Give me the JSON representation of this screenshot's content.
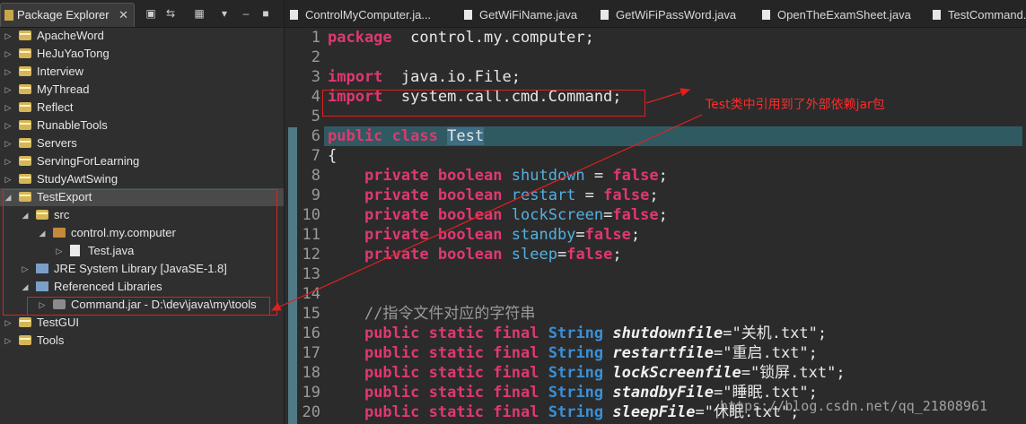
{
  "explorer": {
    "tab_label": "Package Explorer",
    "close_glyph": "✕",
    "items": [
      {
        "label": "ApacheWord",
        "depth": 0,
        "arrow": "right",
        "icon": "project-icon"
      },
      {
        "label": "HeJuYaoTong",
        "depth": 0,
        "arrow": "right",
        "icon": "project-icon"
      },
      {
        "label": "Interview",
        "depth": 0,
        "arrow": "right",
        "icon": "project-icon"
      },
      {
        "label": "MyThread",
        "depth": 0,
        "arrow": "right",
        "icon": "project-icon"
      },
      {
        "label": "Reflect",
        "depth": 0,
        "arrow": "right",
        "icon": "project-icon"
      },
      {
        "label": "RunableTools",
        "depth": 0,
        "arrow": "right",
        "icon": "project-icon"
      },
      {
        "label": "Servers",
        "depth": 0,
        "arrow": "right",
        "icon": "project-icon"
      },
      {
        "label": "ServingForLearning",
        "depth": 0,
        "arrow": "right",
        "icon": "project-icon"
      },
      {
        "label": "StudyAwtSwing",
        "depth": 0,
        "arrow": "right",
        "icon": "project-icon"
      },
      {
        "label": "TestExport",
        "depth": 0,
        "arrow": "down",
        "icon": "project-icon",
        "selected": true
      },
      {
        "label": "src",
        "depth": 1,
        "arrow": "down",
        "icon": "source-folder-icon"
      },
      {
        "label": "control.my.computer",
        "depth": 2,
        "arrow": "down",
        "icon": "package-icon"
      },
      {
        "label": "Test.java",
        "depth": 3,
        "arrow": "right",
        "icon": "java-file-icon"
      },
      {
        "label": "JRE System Library [JavaSE-1.8]",
        "depth": 1,
        "arrow": "right",
        "icon": "library-icon"
      },
      {
        "label": "Referenced Libraries",
        "depth": 1,
        "arrow": "down",
        "icon": "library-icon"
      },
      {
        "label": "Command.jar - D:\\dev\\java\\my\\tools",
        "depth": 2,
        "arrow": "right",
        "icon": "jar-icon"
      },
      {
        "label": "TestGUI",
        "depth": 0,
        "arrow": "right",
        "icon": "project-icon"
      },
      {
        "label": "Tools",
        "depth": 0,
        "arrow": "right",
        "icon": "project-icon"
      }
    ]
  },
  "editor": {
    "tabs": [
      {
        "label": "ControlMyComputer.ja..."
      },
      {
        "label": "GetWiFiName.java"
      },
      {
        "label": "GetWiFiPassWord.java"
      },
      {
        "label": "OpenTheExamSheet.java"
      },
      {
        "label": "TestCommand."
      }
    ],
    "lines": [
      {
        "n": "1",
        "tokens": [
          [
            "kw",
            "package"
          ],
          [
            "",
            "  control.my.computer;"
          ]
        ]
      },
      {
        "n": "2",
        "tokens": []
      },
      {
        "n": "3",
        "tokens": [
          [
            "kw",
            "import"
          ],
          [
            "",
            "  java.io.File;"
          ]
        ]
      },
      {
        "n": "4",
        "tokens": [
          [
            "kw",
            "import"
          ],
          [
            "",
            "  system.call.cmd.Command;"
          ]
        ]
      },
      {
        "n": "5",
        "tokens": []
      },
      {
        "n": "6",
        "tokens": [
          [
            "kw",
            "public"
          ],
          [
            "",
            " "
          ],
          [
            "kw",
            "class"
          ],
          [
            "",
            " "
          ],
          [
            "cls",
            "Test"
          ]
        ]
      },
      {
        "n": "7",
        "tokens": [
          [
            "",
            "{"
          ]
        ]
      },
      {
        "n": "8",
        "tokens": [
          [
            "",
            "    "
          ],
          [
            "kw",
            "private"
          ],
          [
            "",
            " "
          ],
          [
            "kw",
            "boolean"
          ],
          [
            "",
            " "
          ],
          [
            "fld",
            "shutdown"
          ],
          [
            "",
            " = "
          ],
          [
            "kw",
            "false"
          ],
          [
            "",
            ";"
          ]
        ]
      },
      {
        "n": "9",
        "tokens": [
          [
            "",
            "    "
          ],
          [
            "kw",
            "private"
          ],
          [
            "",
            " "
          ],
          [
            "kw",
            "boolean"
          ],
          [
            "",
            " "
          ],
          [
            "fld",
            "restart"
          ],
          [
            "",
            " = "
          ],
          [
            "kw",
            "false"
          ],
          [
            "",
            ";"
          ]
        ]
      },
      {
        "n": "10",
        "tokens": [
          [
            "",
            "    "
          ],
          [
            "kw",
            "private"
          ],
          [
            "",
            " "
          ],
          [
            "kw",
            "boolean"
          ],
          [
            "",
            " "
          ],
          [
            "fld",
            "lockScreen"
          ],
          [
            "",
            "="
          ],
          [
            "kw",
            "false"
          ],
          [
            "",
            ";"
          ]
        ]
      },
      {
        "n": "11",
        "tokens": [
          [
            "",
            "    "
          ],
          [
            "kw",
            "private"
          ],
          [
            "",
            " "
          ],
          [
            "kw",
            "boolean"
          ],
          [
            "",
            " "
          ],
          [
            "fld",
            "standby"
          ],
          [
            "",
            "="
          ],
          [
            "kw",
            "false"
          ],
          [
            "",
            ";"
          ]
        ]
      },
      {
        "n": "12",
        "tokens": [
          [
            "",
            "    "
          ],
          [
            "kw",
            "private"
          ],
          [
            "",
            " "
          ],
          [
            "kw",
            "boolean"
          ],
          [
            "",
            " "
          ],
          [
            "fld",
            "sleep"
          ],
          [
            "",
            "="
          ],
          [
            "kw",
            "false"
          ],
          [
            "",
            ";"
          ]
        ]
      },
      {
        "n": "13",
        "tokens": []
      },
      {
        "n": "14",
        "tokens": []
      },
      {
        "n": "15",
        "tokens": [
          [
            "",
            "    "
          ],
          [
            "cmt",
            "//指令文件对应的字符串"
          ]
        ]
      },
      {
        "n": "16",
        "tokens": [
          [
            "",
            "    "
          ],
          [
            "kw",
            "public"
          ],
          [
            "",
            " "
          ],
          [
            "kw",
            "static"
          ],
          [
            "",
            " "
          ],
          [
            "kw",
            "final"
          ],
          [
            "",
            " "
          ],
          [
            "ty",
            "String"
          ],
          [
            "",
            " "
          ],
          [
            "sfld",
            "shutdownfile"
          ],
          [
            "str",
            "=\"关机.txt\";"
          ]
        ]
      },
      {
        "n": "17",
        "tokens": [
          [
            "",
            "    "
          ],
          [
            "kw",
            "public"
          ],
          [
            "",
            " "
          ],
          [
            "kw",
            "static"
          ],
          [
            "",
            " "
          ],
          [
            "kw",
            "final"
          ],
          [
            "",
            " "
          ],
          [
            "ty",
            "String"
          ],
          [
            "",
            " "
          ],
          [
            "sfld",
            "restartfile"
          ],
          [
            "str",
            "=\"重启.txt\";"
          ]
        ]
      },
      {
        "n": "18",
        "tokens": [
          [
            "",
            "    "
          ],
          [
            "kw",
            "public"
          ],
          [
            "",
            " "
          ],
          [
            "kw",
            "static"
          ],
          [
            "",
            " "
          ],
          [
            "kw",
            "final"
          ],
          [
            "",
            " "
          ],
          [
            "ty",
            "String"
          ],
          [
            "",
            " "
          ],
          [
            "sfld",
            "lockScreenfile"
          ],
          [
            "str",
            "=\"锁屏.txt\";"
          ]
        ]
      },
      {
        "n": "19",
        "tokens": [
          [
            "",
            "    "
          ],
          [
            "kw",
            "public"
          ],
          [
            "",
            " "
          ],
          [
            "kw",
            "static"
          ],
          [
            "",
            " "
          ],
          [
            "kw",
            "final"
          ],
          [
            "",
            " "
          ],
          [
            "ty",
            "String"
          ],
          [
            "",
            " "
          ],
          [
            "sfld",
            "standbyFile"
          ],
          [
            "str",
            "=\"睡眠.txt\";"
          ]
        ]
      },
      {
        "n": "20",
        "tokens": [
          [
            "",
            "    "
          ],
          [
            "kw",
            "public"
          ],
          [
            "",
            " "
          ],
          [
            "kw",
            "static"
          ],
          [
            "",
            " "
          ],
          [
            "kw",
            "final"
          ],
          [
            "",
            " "
          ],
          [
            "ty",
            "String"
          ],
          [
            "",
            " "
          ],
          [
            "sfld",
            "sleepFile"
          ],
          [
            "str",
            "=\"休眠.txt\";"
          ]
        ]
      }
    ]
  },
  "annotation": {
    "text": "Test类中引用到了外部依赖jar包",
    "color": "#ff2a2a"
  },
  "watermark": "https://blog.csdn.net/qq_21808961",
  "colors": {
    "keyword": "#e0386f",
    "type": "#3a8fd6",
    "highlight_line": "#2f5a62"
  }
}
